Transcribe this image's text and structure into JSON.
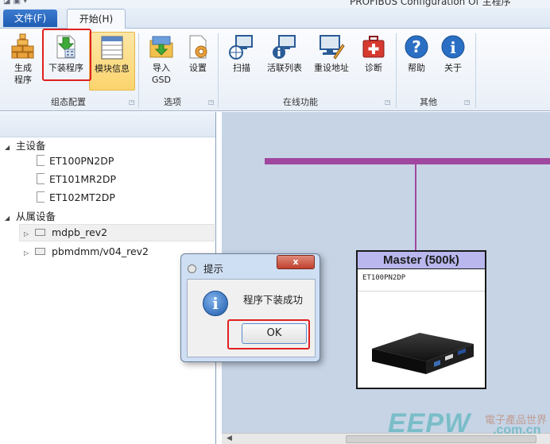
{
  "window": {
    "title_partial": "PROFIBUS Configuration Of 主程序",
    "quick_access": "◪ ▣ ▾"
  },
  "tabs": {
    "file": "文件(F)",
    "home": "开始(H)"
  },
  "ribbon": {
    "buttons": {
      "generate": "生成\n程序",
      "download": "下装程序",
      "module_info": "模块信息",
      "import_gsd": "导入\nGSD",
      "settings": "设置",
      "scan": "扫描",
      "active_list": "活联列表",
      "reset_address": "重设地址",
      "diagnose": "诊断",
      "help": "帮助",
      "about": "关于"
    },
    "groups": {
      "config": "组态配置",
      "options": "选项",
      "online": "在线功能",
      "other": "其他"
    }
  },
  "tree": {
    "master_group": "主设备",
    "masters": [
      "ET100PN2DP",
      "ET101MR2DP",
      "ET102MT2DP"
    ],
    "slave_group": "从属设备",
    "slaves": [
      "mdpb_rev2",
      "pbmdmm/v04_rev2"
    ]
  },
  "canvas": {
    "master_title": "Master (500k)",
    "master_model": "ET100PN2DP",
    "bus_color": "#a0479f"
  },
  "dialog": {
    "title": "提示",
    "close": "x",
    "message": "程序下装成功",
    "ok": "OK"
  },
  "watermark": {
    "brand": "EEPW",
    "cn": "電子產品世界",
    "domain": ".com.cn"
  },
  "colors": {
    "highlight_box": "#e02020",
    "selected_button": "#fbd46c",
    "file_tab": "#1f5db3"
  }
}
